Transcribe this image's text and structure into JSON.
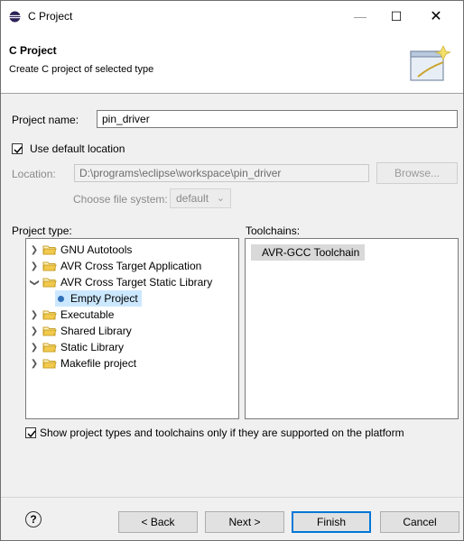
{
  "window": {
    "title": "C Project",
    "icon": "eclipse-icon",
    "minimize_glyph": "—",
    "maximize_glyph": "☐",
    "close_glyph": "✕"
  },
  "banner": {
    "title": "C Project",
    "description": "Create C project of selected type",
    "image": "wizard-banner-icon"
  },
  "form": {
    "project_name_label": "Project name:",
    "project_name_value": "pin_driver",
    "use_default_location_label": "Use default location",
    "use_default_location_checked": true,
    "location_label": "Location:",
    "location_value": "D:\\programs\\eclipse\\workspace\\pin_driver",
    "browse_label": "Browse...",
    "file_system_label": "Choose file system:",
    "file_system_value": "default"
  },
  "project_type": {
    "label": "Project type:",
    "items": [
      {
        "label": "GNU Autotools",
        "expanded": false
      },
      {
        "label": "AVR Cross Target Application",
        "expanded": false
      },
      {
        "label": "AVR Cross Target Static Library",
        "expanded": true
      },
      {
        "label": "Empty Project",
        "child": true,
        "selected": true
      },
      {
        "label": "Executable",
        "expanded": false
      },
      {
        "label": "Shared Library",
        "expanded": false
      },
      {
        "label": "Static Library",
        "expanded": false
      },
      {
        "label": "Makefile project",
        "expanded": false
      }
    ]
  },
  "toolchains": {
    "label": "Toolchains:",
    "items": [
      "AVR-GCC Toolchain"
    ]
  },
  "filter_checkbox": {
    "label": "Show project types and toolchains only if they are supported on the platform",
    "checked": true
  },
  "buttons": {
    "help_glyph": "?",
    "back": "< Back",
    "next": "Next >",
    "finish": "Finish",
    "cancel": "Cancel"
  },
  "colors": {
    "selection": "#cce8ff",
    "primary_border": "#0078d7",
    "folder": "#f2c94c"
  }
}
